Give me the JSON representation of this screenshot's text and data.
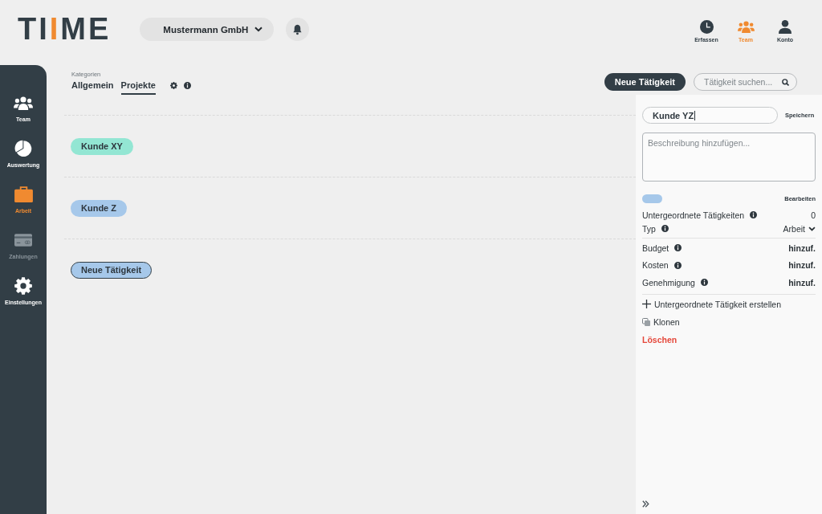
{
  "header": {
    "logo": {
      "parts": [
        {
          "text": "TI",
          "color": "#323e46"
        },
        {
          "text": "I",
          "color": "#f08a30"
        },
        {
          "text": "ME",
          "color": "#323e46"
        }
      ]
    },
    "company_selector": {
      "value": "Mustermann GmbH"
    },
    "nav": [
      {
        "label": "Erfassen",
        "selected": false
      },
      {
        "label": "Team",
        "selected": true
      },
      {
        "label": "Konto",
        "selected": false
      }
    ]
  },
  "sidebar": {
    "items": [
      {
        "label": "Team",
        "selected": false,
        "disabled": false
      },
      {
        "label": "Auswertung",
        "selected": false,
        "disabled": false
      },
      {
        "label": "Arbeit",
        "selected": true,
        "disabled": false
      },
      {
        "label": "Zahlungen",
        "selected": false,
        "disabled": true
      },
      {
        "label": "Einstellungen",
        "selected": false,
        "disabled": false
      }
    ]
  },
  "categories": {
    "title": "Kategorien",
    "tabs": [
      {
        "label": "Allgemein",
        "selected": false
      },
      {
        "label": "Projekte",
        "selected": true
      }
    ]
  },
  "toolbar": {
    "new_button": "Neue Tätigkeit",
    "search": {
      "placeholder": "Tätigkeit suchen..."
    }
  },
  "activities": [
    {
      "label": "Kunde XY",
      "color": "#93e6d3",
      "selected": false
    },
    {
      "label": "Kunde Z",
      "color": "#a6c8ea",
      "selected": false
    },
    {
      "label": "Neue Tätigkeit",
      "color": "#a6c8ea",
      "selected": true
    }
  ],
  "detail_panel": {
    "name": {
      "value": "Kunde YZ"
    },
    "save_button": "Speichern",
    "description": {
      "placeholder": "Beschreibung hinzufügen..."
    },
    "color": "#a6c8ea",
    "edit_button": "Bearbeiten",
    "properties": [
      {
        "label": "Untergeordnete Tätigkeiten",
        "value": "0",
        "kind": "count"
      },
      {
        "label": "Typ",
        "value": "Arbeit",
        "kind": "select"
      }
    ],
    "settings": [
      {
        "label": "Budget",
        "value": "hinzuf.",
        "kind": "add"
      },
      {
        "label": "Kosten",
        "value": "hinzuf.",
        "kind": "add"
      },
      {
        "label": "Genehmigung",
        "value": "hinzuf.",
        "kind": "add"
      }
    ],
    "actions": [
      {
        "label": "Untergeordnete Tätigkeit erstellen",
        "kind": "add"
      },
      {
        "label": "Klonen",
        "kind": "clone"
      },
      {
        "label": "Löschen",
        "kind": "delete"
      }
    ]
  }
}
